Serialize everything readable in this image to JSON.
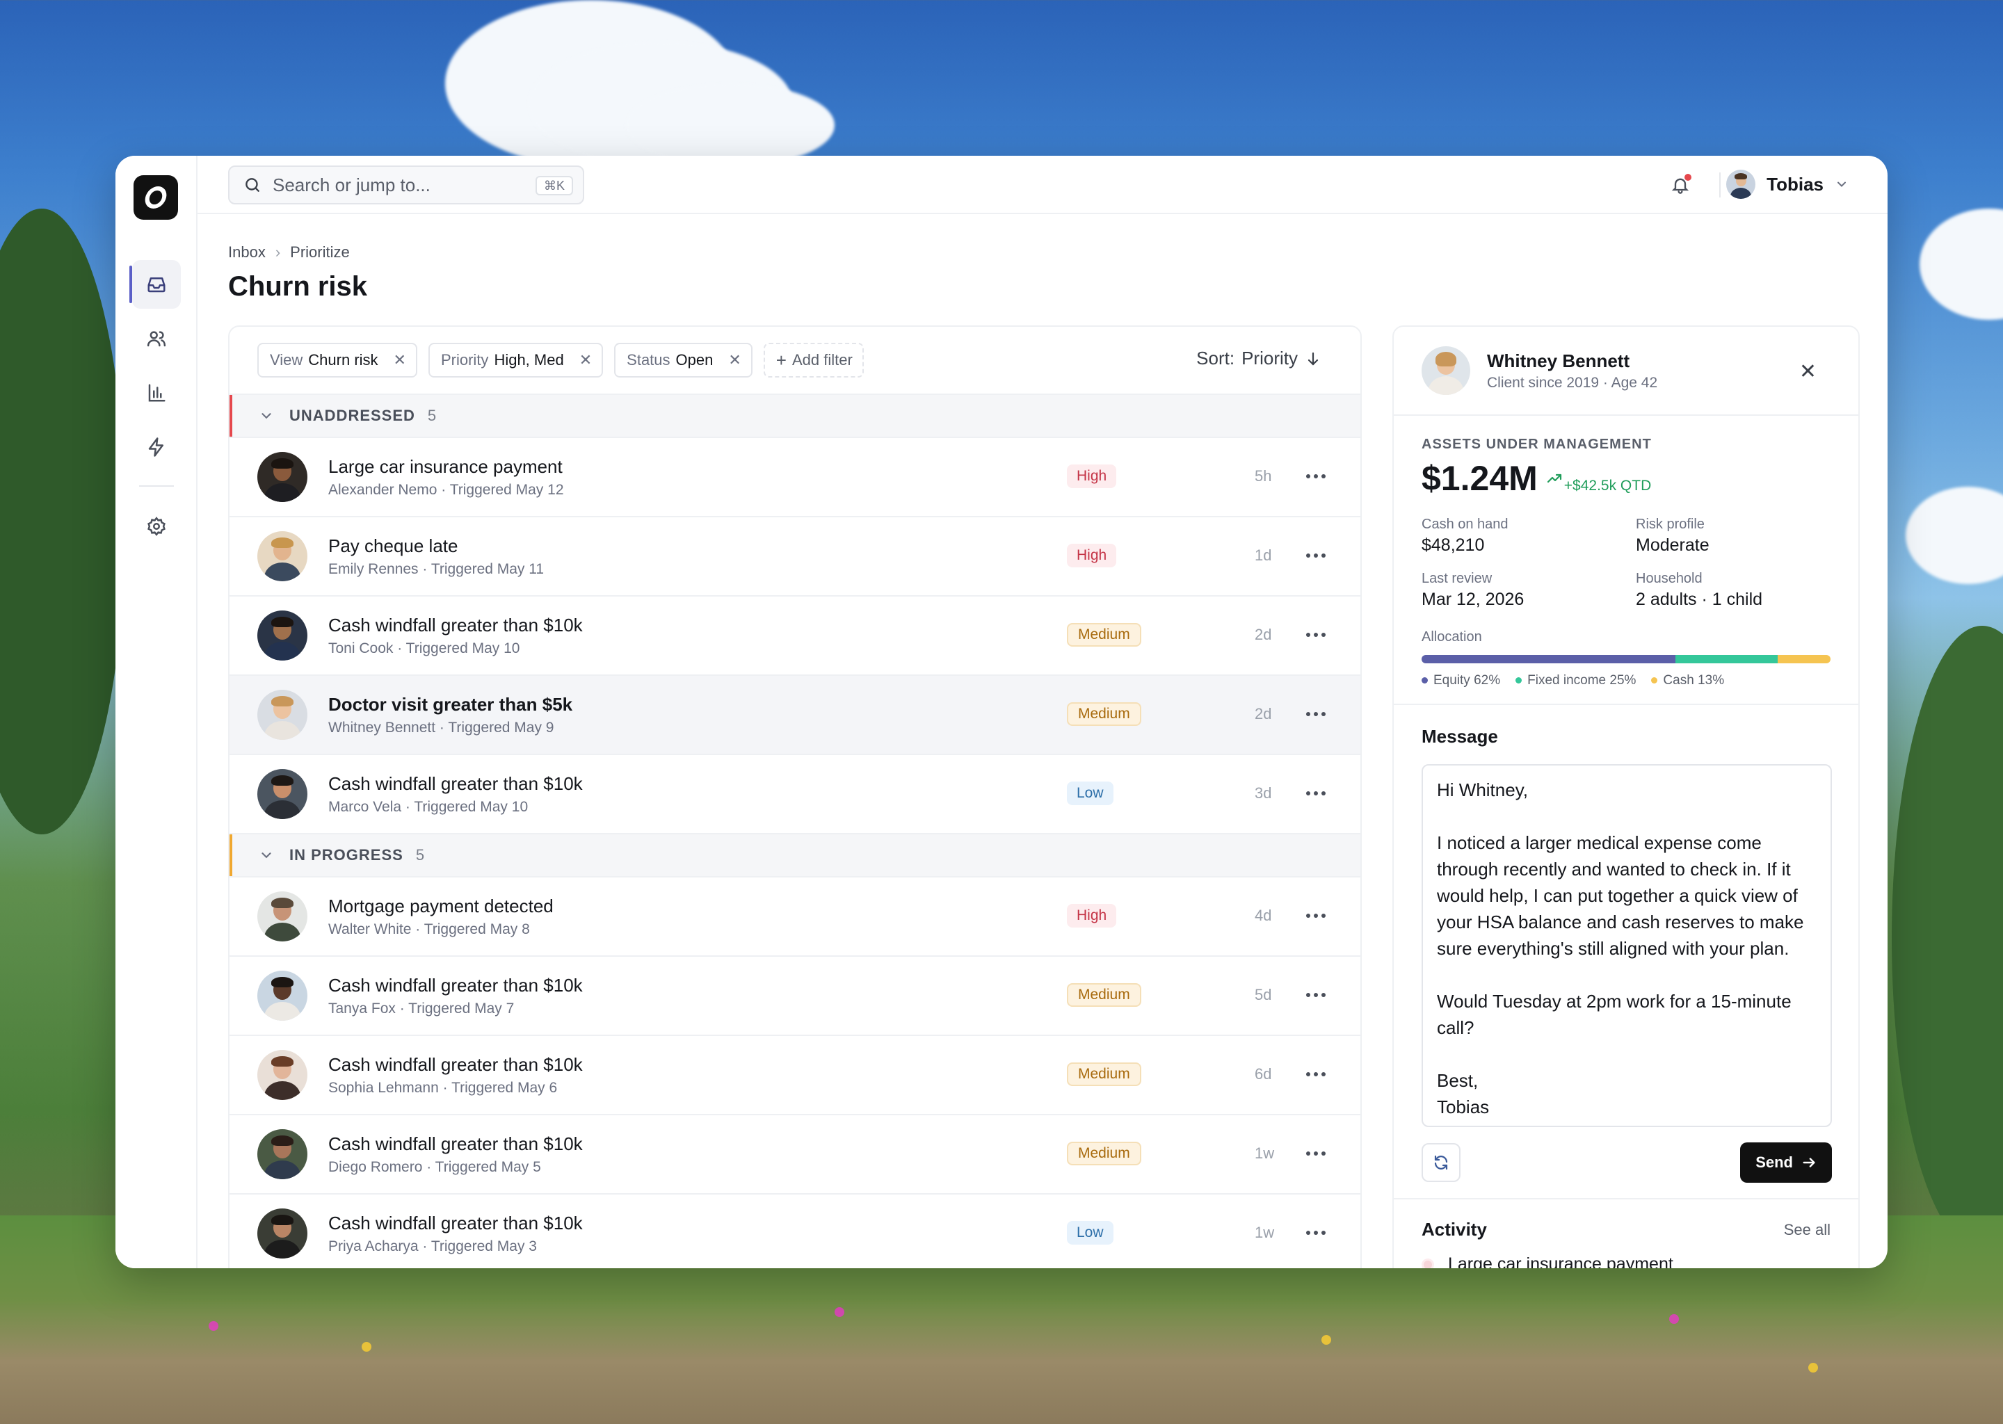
{
  "colors": {
    "accent": "#5b5fc7",
    "high_text": "#c43346",
    "medium_text": "#a86a0d",
    "low_text": "#2c6ea8",
    "unaddressed_bar": "#e5484d",
    "in_progress_bar": "#f0a830",
    "equity": "#5b5fa8",
    "fixed_income": "#34c79a",
    "cash": "#f5c451"
  },
  "app": {
    "logo_icon": "app-logo-icon",
    "rail": [
      "inbox-icon",
      "users-icon",
      "bar-chart-icon",
      "lightning-icon",
      "settings-icon"
    ]
  },
  "topbar": {
    "search_placeholder": "Search or jump to...",
    "search_shortcut": "⌘K",
    "user_name": "Tobias"
  },
  "breadcrumb": {
    "items": [
      "Inbox",
      "Prioritize"
    ]
  },
  "page_title": "Churn risk",
  "filters": [
    {
      "key": "View",
      "value": "Churn risk"
    },
    {
      "key": "Priority",
      "value": "High, Med"
    },
    {
      "key": "Status",
      "value": "Open"
    }
  ],
  "add_filter_label": "Add filter",
  "sort": {
    "label": "Sort:",
    "value": "Priority"
  },
  "groups": [
    {
      "label": "UNADDRESSED",
      "count": "5",
      "rows": [
        {
          "title": "Large car insurance payment",
          "sub": "Alexander Nemo · Triggered May 12",
          "priority": "High",
          "age": "5h"
        },
        {
          "title": "Pay cheque late",
          "sub": "Emily Rennes · Triggered May 11",
          "priority": "High",
          "age": "1d"
        },
        {
          "title": "Cash windfall greater than $10k",
          "sub": "Toni Cook · Triggered May 10",
          "priority": "Medium",
          "age": "2d"
        },
        {
          "title": "Doctor visit greater than $5k",
          "sub": "Whitney Bennett · Triggered May 9",
          "priority": "Medium",
          "age": "2d"
        },
        {
          "title": "Cash windfall greater than $10k",
          "sub": "Marco Vela · Triggered May 10",
          "priority": "Low",
          "age": "3d"
        }
      ]
    },
    {
      "label": "IN PROGRESS",
      "count": "5",
      "rows": [
        {
          "title": "Mortgage payment detected",
          "sub": "Walter White · Triggered May 8",
          "priority": "High",
          "age": "4d"
        },
        {
          "title": "Cash windfall greater than $10k",
          "sub": "Tanya Fox · Triggered May 7",
          "priority": "Medium",
          "age": "5d"
        },
        {
          "title": "Cash windfall greater than $10k",
          "sub": "Sophia Lehmann · Triggered May 6",
          "priority": "Medium",
          "age": "6d"
        },
        {
          "title": "Cash windfall greater than $10k",
          "sub": "Diego Romero · Triggered May 5",
          "priority": "Medium",
          "age": "1w"
        },
        {
          "title": "Cash windfall greater than $10k",
          "sub": "Priya Acharya · Triggered May 3",
          "priority": "Low",
          "age": "1w"
        }
      ]
    }
  ],
  "detail": {
    "name": "Whitney Bennett",
    "subtitle": "Client since 2019 · Age 42",
    "aum_label": "ASSETS UNDER MANAGEMENT",
    "aum_value": "$1.24M",
    "aum_delta": "+$42.5k QTD",
    "stats": [
      {
        "k": "Cash on hand",
        "v": "$48,210"
      },
      {
        "k": "Risk profile",
        "v": "Moderate"
      },
      {
        "k": "Last review",
        "v": "Mar 12, 2026"
      },
      {
        "k": "Household",
        "v": "2 adults · 1 child"
      }
    ],
    "allocation_label": "Allocation",
    "allocation": [
      {
        "label": "Equity 62%",
        "pct": 62
      },
      {
        "label": "Fixed income 25%",
        "pct": 25
      },
      {
        "label": "Cash 13%",
        "pct": 13
      }
    ],
    "message_label": "Message",
    "message_body": "Hi Whitney,\n\nI noticed a larger medical expense come through recently and wanted to check in. If it would help, I can put together a quick view of your HSA balance and cash reserves to make sure everything's still aligned with your plan.\n\nWould Tuesday at 2pm work for a 15-minute call?\n\nBest,\nTobias",
    "send_label": "Send",
    "activity_label": "Activity",
    "see_all_label": "See all",
    "activity_first": "Large car insurance payment"
  }
}
